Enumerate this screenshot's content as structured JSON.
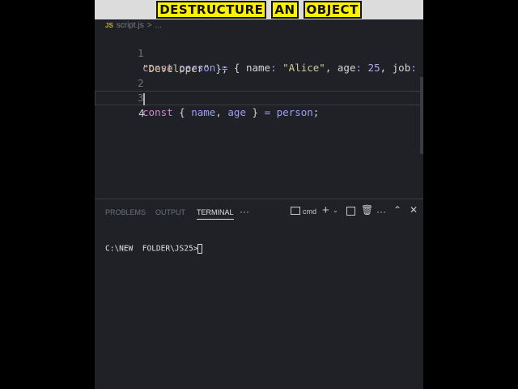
{
  "banner": {
    "words": [
      "DESTRUCTURE",
      "AN",
      "OBJECT"
    ]
  },
  "breadcrumb": {
    "icon": "JS",
    "file": "script.js",
    "sep": ">",
    "more": "..."
  },
  "editor": {
    "line_numbers": [
      "1",
      "2",
      "3",
      "4"
    ],
    "line1": [
      "const",
      " person",
      " =",
      " {",
      " name",
      ":",
      " \"Alice\"",
      ",",
      " age",
      ":",
      " 25",
      ",",
      " job",
      ":"
    ],
    "line1b": [
      "\"Developer\"",
      " };"
    ],
    "line3": [
      "const",
      " {",
      " name",
      ",",
      " age",
      " }",
      " =",
      " person",
      ";"
    ]
  },
  "panel": {
    "tabs": [
      "PROBLEMS",
      "OUTPUT",
      "TERMINAL"
    ],
    "more": "···",
    "shell": "cmd",
    "terminal_prompt": "C:\\NEW  FOLDER\\JS25>"
  }
}
